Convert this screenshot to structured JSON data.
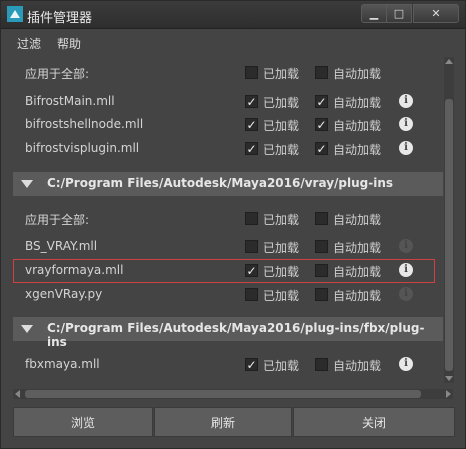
{
  "window": {
    "title": "插件管理器"
  },
  "menu": {
    "filter": "过滤",
    "help": "帮助"
  },
  "labels": {
    "loaded": "已加载",
    "auto_load": "自动加载",
    "apply_all": "应用于全部:"
  },
  "sections": [
    {
      "path": "",
      "rows": [
        {
          "name": "",
          "loaded": false,
          "auto": false,
          "info": false
        },
        {
          "name": "BifrostMain.mll",
          "loaded": true,
          "auto": true,
          "info": true
        },
        {
          "name": "bifrostshellnode.mll",
          "loaded": true,
          "auto": true,
          "info": true
        },
        {
          "name": "bifrostvisplugin.mll",
          "loaded": true,
          "auto": true,
          "info": true
        }
      ]
    },
    {
      "path": "C:/Program Files/Autodesk/Maya2016/vray/plug-ins",
      "rows": [
        {
          "name": "BS_VRAY.mll",
          "loaded": false,
          "auto": false,
          "info": "dim"
        },
        {
          "name": "vrayformaya.mll",
          "loaded": true,
          "auto": false,
          "info": true,
          "highlighted": true
        },
        {
          "name": "xgenVRay.py",
          "loaded": false,
          "auto": false,
          "info": "dim"
        }
      ]
    },
    {
      "path": "C:/Program Files/Autodesk/Maya2016/plug-ins/fbx/plug-ins",
      "rows": [
        {
          "name": "fbxmaya.mll",
          "loaded": true,
          "auto": false,
          "info": true
        }
      ]
    }
  ],
  "buttons": {
    "browse": "浏览",
    "refresh": "刷新",
    "close": "关闭"
  },
  "colors": {
    "highlight_border": "#d04040",
    "section_bg": "#5b5b5b",
    "window_bg": "#444444"
  }
}
